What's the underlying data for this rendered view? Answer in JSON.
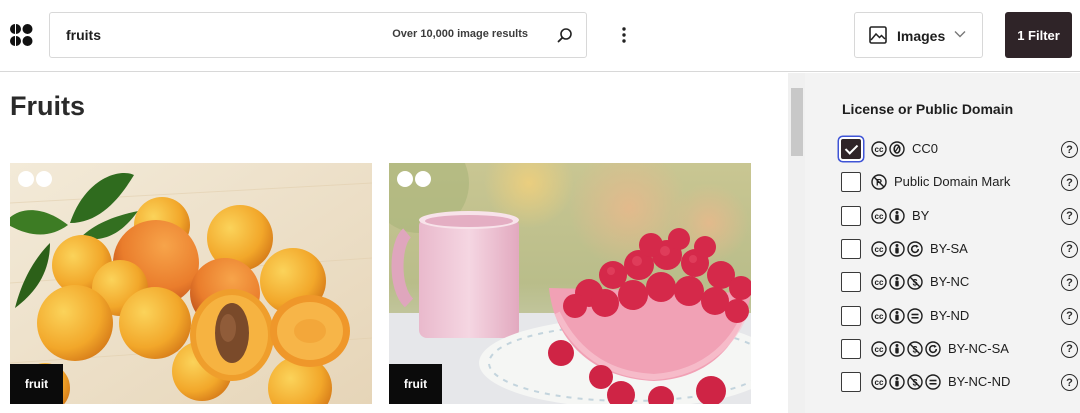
{
  "search": {
    "query": "fruits",
    "result_count": "Over 10,000 image results"
  },
  "header": {
    "content_type": "Images",
    "filter_button": "1 Filter"
  },
  "main": {
    "title": "Fruits",
    "results": [
      {
        "tag": "fruit",
        "icons": [
          "cc-icon",
          "zero-icon"
        ],
        "subject": "apricots"
      },
      {
        "tag": "fruit",
        "icons": [
          "cc-icon",
          "zero-icon"
        ],
        "subject": "raspberries-and-pink-mug"
      }
    ]
  },
  "filters": {
    "title": "License or Public Domain",
    "help": "?",
    "options": [
      {
        "label": "CC0",
        "checked": true,
        "icons": [
          "cc",
          "zero"
        ]
      },
      {
        "label": "Public Domain Mark",
        "checked": false,
        "icons": [
          "pd"
        ]
      },
      {
        "label": "BY",
        "checked": false,
        "icons": [
          "cc",
          "by"
        ]
      },
      {
        "label": "BY-SA",
        "checked": false,
        "icons": [
          "cc",
          "by",
          "sa"
        ]
      },
      {
        "label": "BY-NC",
        "checked": false,
        "icons": [
          "cc",
          "by",
          "nc"
        ]
      },
      {
        "label": "BY-ND",
        "checked": false,
        "icons": [
          "cc",
          "by",
          "nd"
        ]
      },
      {
        "label": "BY-NC-SA",
        "checked": false,
        "icons": [
          "cc",
          "by",
          "nc",
          "sa"
        ]
      },
      {
        "label": "BY-NC-ND",
        "checked": false,
        "icons": [
          "cc",
          "by",
          "nc",
          "nd"
        ]
      }
    ]
  },
  "colors": {
    "accent": "#2f2428",
    "focus": "#3f54d6",
    "panel_bg": "#f3f3f3"
  }
}
